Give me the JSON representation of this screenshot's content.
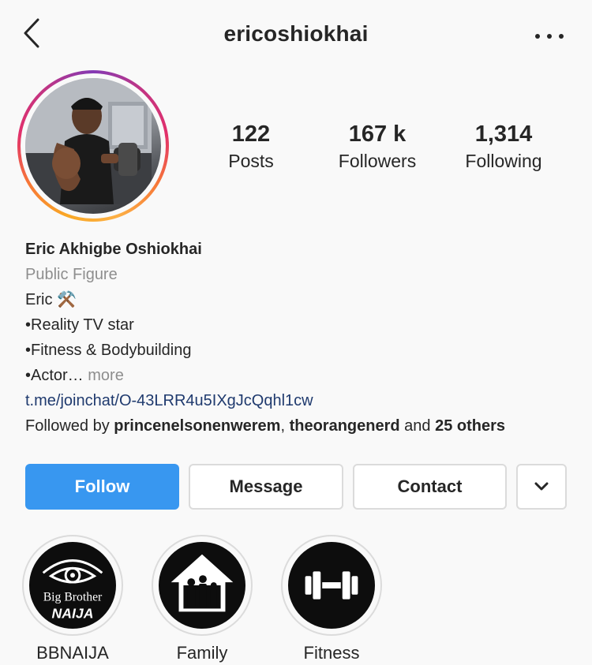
{
  "header": {
    "username": "ericoshiokhai",
    "back_icon": "chevron-left-icon",
    "more_icon": "more-horizontal-icon"
  },
  "stats": [
    {
      "value": "122",
      "label": "Posts"
    },
    {
      "value": "167 k",
      "label": "Followers"
    },
    {
      "value": "1,314",
      "label": "Following"
    }
  ],
  "bio": {
    "name": "Eric Akhigbe Oshiokhai",
    "category": "Public Figure",
    "line1": "Eric ⚒️",
    "line2": "•Reality TV star",
    "line3": "•Fitness & Bodybuilding",
    "line4": "•Actor…",
    "more": "more",
    "link": "t.me/joinchat/O-43LRR4u5IXgJcQqhl1cw",
    "followed_prefix": "Followed by ",
    "followed_user1": "princenelsonenwerem",
    "followed_sep": ", ",
    "followed_user2": "theorangenerd",
    "followed_and": " and ",
    "followed_others": "25 others"
  },
  "actions": {
    "follow": "Follow",
    "message": "Message",
    "contact": "Contact",
    "chevron_icon": "chevron-down-icon"
  },
  "highlights": [
    {
      "label": "BBNAIJA",
      "logo_text_1": "Big Brother",
      "logo_text_2": "NAIJA"
    },
    {
      "label": "Family"
    },
    {
      "label": "Fitness"
    }
  ],
  "colors": {
    "follow_blue": "#3897f0",
    "link_blue": "#1f3a6e",
    "muted": "#8e8e8e",
    "text": "#262626"
  }
}
